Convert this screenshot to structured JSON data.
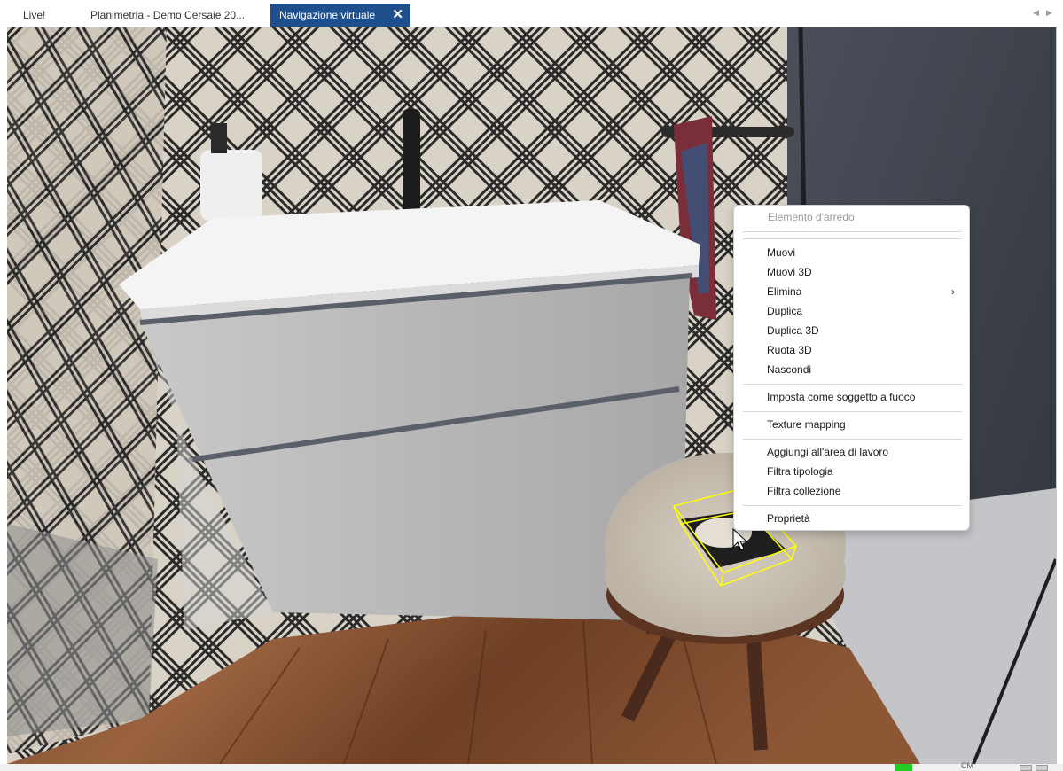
{
  "tabs": [
    {
      "label": "Live!",
      "active": false
    },
    {
      "label": "Planimetria - Demo Cersaie 20...",
      "active": false
    },
    {
      "label": "Navigazione virtuale",
      "active": true
    }
  ],
  "tab_close_icon": "close-icon",
  "tab_scroll": {
    "left": "◀",
    "right": "▶"
  },
  "context_menu": {
    "header": "Elemento d'arredo",
    "items": [
      {
        "label": "Muovi"
      },
      {
        "label": "Muovi 3D"
      },
      {
        "label": "Elimina",
        "submenu_arrow": "›"
      },
      {
        "label": "Duplica"
      },
      {
        "label": "Duplica 3D"
      },
      {
        "label": "Ruota 3D"
      },
      {
        "label": "Nascondi"
      },
      {
        "label": "Imposta come soggetto a fuoco"
      },
      {
        "label": "Texture mapping"
      },
      {
        "label": "Aggiungi all'area di lavoro"
      },
      {
        "label": "Filtra tipologia"
      },
      {
        "label": "Filtra collezione"
      },
      {
        "label": "Proprietà"
      }
    ]
  },
  "status_bar": {
    "text": "CM",
    "indicator_color": "#22cc22"
  },
  "colors": {
    "tab_active": "#1f4e8c",
    "selection_box": "#ffff00"
  }
}
